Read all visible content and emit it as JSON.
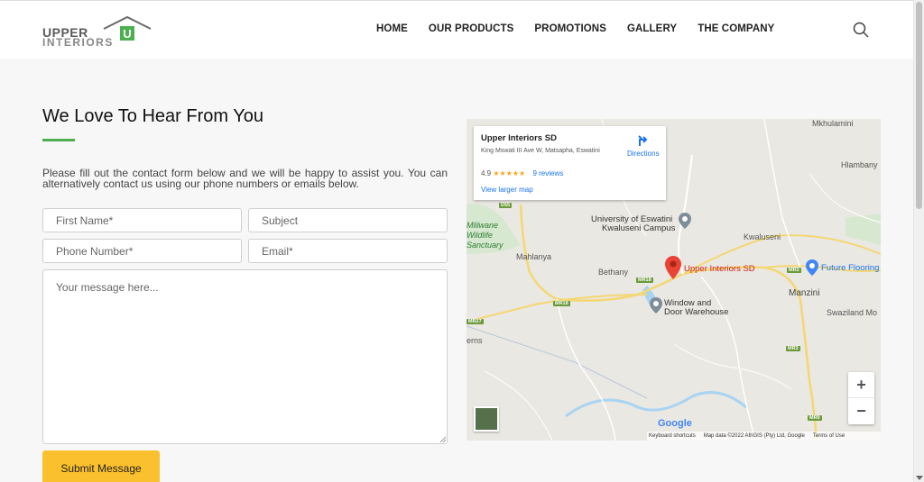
{
  "header": {
    "logo": {
      "word1": "UPPER",
      "word2": "INTERIORS",
      "mark": "U"
    },
    "nav": [
      "HOME",
      "OUR PRODUCTS",
      "PROMOTIONS",
      "GALLERY",
      "THE COMPANY"
    ],
    "search_icon": "search-icon"
  },
  "contact": {
    "title": "We Love To Hear From You",
    "intro": "Please fill out the contact form below and we will be happy to assist you. You can alternatively contact us using our phone numbers or emails below.",
    "fields": {
      "first_name": "First Name*",
      "subject": "Subject",
      "phone": "Phone Number*",
      "email": "Email*",
      "message": "Your message here..."
    },
    "submit": "Submit Message",
    "accent_color": "#4caf50",
    "button_color": "#fbc02d"
  },
  "map": {
    "card": {
      "name": "Upper Interiors SD",
      "address": "King Mswati III Ave W, Matsapha, Eswatini",
      "rating": "4.9",
      "stars": "★★★★★",
      "reviews": "9 reviews",
      "larger": "View larger map",
      "directions": "Directions"
    },
    "labels": {
      "mkhulamini": "Mkhulamini",
      "hlambany": "Hlambany",
      "university": "University of Eswatini",
      "campus": "Kwaluseni Campus",
      "kwaluseni": "Kwaluseni",
      "mahlanya": "Mahlanya",
      "bethany": "Bethany",
      "pin_label": "Upper Interiors SD",
      "future": "Future Flooring",
      "manzini": "Manzini",
      "swaziland": "Swaziland Mo",
      "window1": "Window and",
      "window2": "Door Warehouse",
      "mlilwane1": "Mlilwane",
      "mlilwane2": "Wildlife",
      "mlilwane3": "Sanctuary",
      "erns": "erns"
    },
    "shields": [
      "D55",
      "MR18",
      "MR18",
      "MR27",
      "MR3",
      "MR3",
      "MR9"
    ],
    "zoom_in": "+",
    "zoom_out": "−",
    "google": "Google",
    "attribution": {
      "shortcuts": "Keyboard shortcuts",
      "data": "Map data ©2022 AfriGIS (Pty) Ltd, Google",
      "terms": "Terms of Use"
    }
  }
}
